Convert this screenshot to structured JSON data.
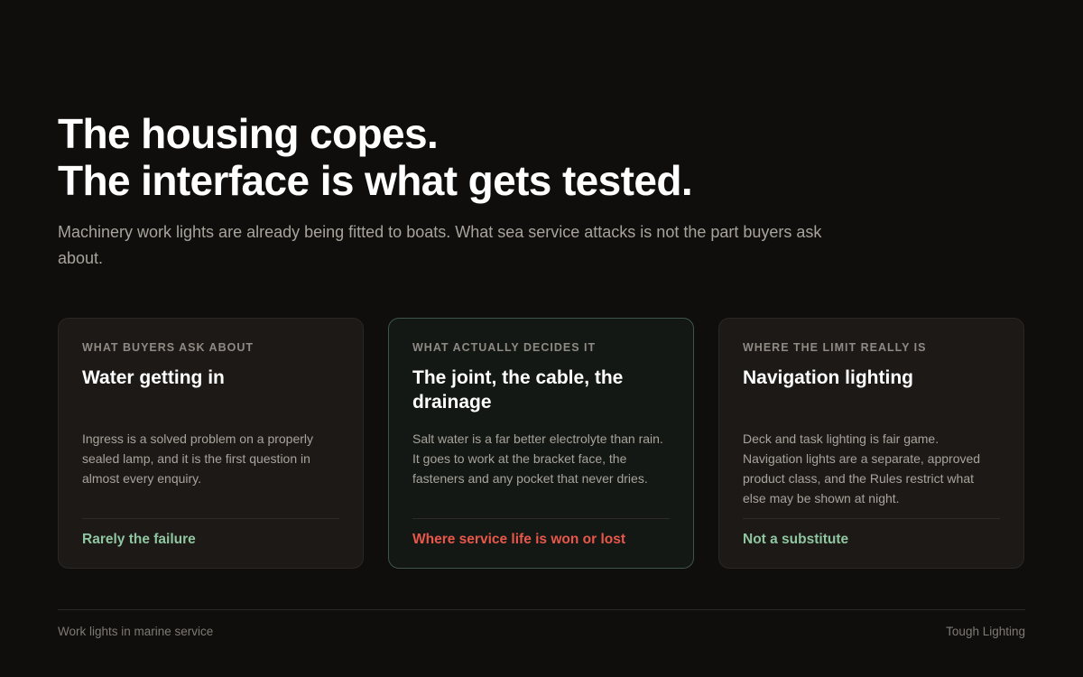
{
  "headline": {
    "line1": "The housing copes.",
    "line2": "The interface is what gets tested."
  },
  "lede": "Machinery work lights are already being fitted to boats. What sea service attacks is not the part buyers ask about.",
  "cards": [
    {
      "eyebrow": "WHAT BUYERS ASK ABOUT",
      "title": "Water getting in",
      "body": "Ingress is a solved problem on a properly sealed lamp, and it is the first question in almost every enquiry.",
      "verdict": "Rarely the failure"
    },
    {
      "eyebrow": "WHAT ACTUALLY DECIDES IT",
      "title": "The joint, the cable, the drainage",
      "body": "Salt water is a far better electrolyte than rain. It goes to work at the bracket face, the fasteners and any pocket that never dries.",
      "verdict": "Where service life is won or lost"
    },
    {
      "eyebrow": "WHERE THE LIMIT REALLY IS",
      "title": "Navigation lighting",
      "body": "Deck and task lighting is fair game. Navigation lights are a separate, approved product class, and the Rules restrict what else may be shown at night.",
      "verdict": "Not a substitute"
    }
  ],
  "footer": {
    "left": "Work lights in marine service",
    "right": "Tough Lighting"
  },
  "colors": {
    "background": "#0f0e0d",
    "card": "#1c1917",
    "card_highlight": "#131815",
    "verdict_positive": "#8fc6a0",
    "verdict_negative": "#e8574a"
  }
}
